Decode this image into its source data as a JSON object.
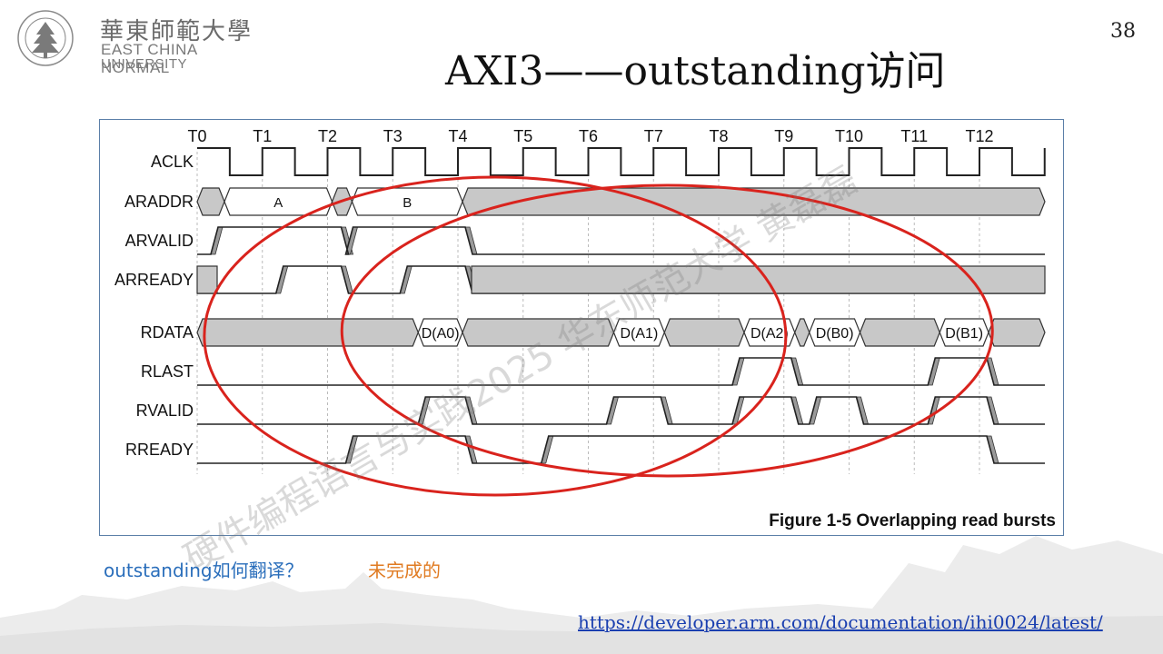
{
  "logo": {
    "cn_name": "華東師範大學",
    "en_line1": "EAST CHINA NORMAL",
    "en_line2": "UNIVERSITY",
    "seal_text": "EAST CHINA NORMAL UNIVERSITY"
  },
  "page_number": "38",
  "title": "AXI3——outstanding访问",
  "figure": {
    "caption": "Figure 1-5 Overlapping read bursts",
    "time_labels": [
      "T0",
      "T1",
      "T2",
      "T3",
      "T4",
      "T5",
      "T6",
      "T7",
      "T8",
      "T9",
      "T10",
      "T11",
      "T12"
    ],
    "signals": [
      "ACLK",
      "ARADDR",
      "ARVALID",
      "ARREADY",
      "RDATA",
      "RLAST",
      "RVALID",
      "RREADY"
    ],
    "araddr_values": [
      "A",
      "B"
    ],
    "rdata_values": [
      "D(A0)",
      "D(A1)",
      "D(A2)",
      "D(B0)",
      "D(B1)"
    ],
    "annotation_color": "#d9231d"
  },
  "watermark": "硬件编程语言与实践2025 华东师范大学 黄磊磊",
  "note": {
    "question": "outstanding如何翻译？",
    "answer": "未完成的"
  },
  "link": "https://developer.arm.com/documentation/ihi0024/latest/"
}
